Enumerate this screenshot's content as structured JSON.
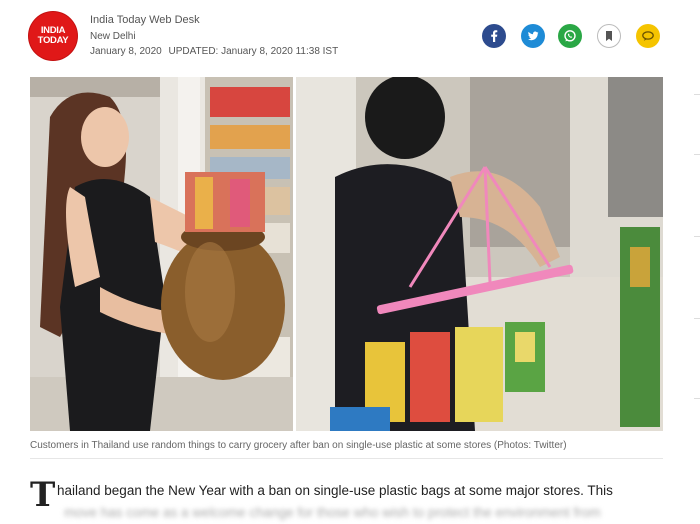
{
  "header": {
    "logo_line1": "INDIA",
    "logo_line2": "TODAY",
    "author": "India Today Web Desk",
    "location": "New Delhi",
    "published": "January 8, 2020",
    "updated": "UPDATED: January 8, 2020 11:38 IST"
  },
  "share": {
    "icons": [
      "facebook-icon",
      "twitter-icon",
      "whatsapp-icon",
      "bookmark-icon",
      "comment-icon"
    ],
    "colors": {
      "facebook": "#2d4b8e",
      "twitter": "#1e8bd6",
      "whatsapp": "#2aa745",
      "comment": "#f5c400"
    }
  },
  "photo": {
    "caption": "Customers in Thailand use random things to carry grocery after ban on single-use plastic at some stores (Photos: Twitter)"
  },
  "article": {
    "dropcap": "T",
    "line1": "hailand began the New Year with a ban on single-use plastic bags at some major stores. This",
    "line2": "move has come as a welcome change for those who wish to protect the environment from"
  },
  "brand": {
    "accent": "#e01818"
  }
}
